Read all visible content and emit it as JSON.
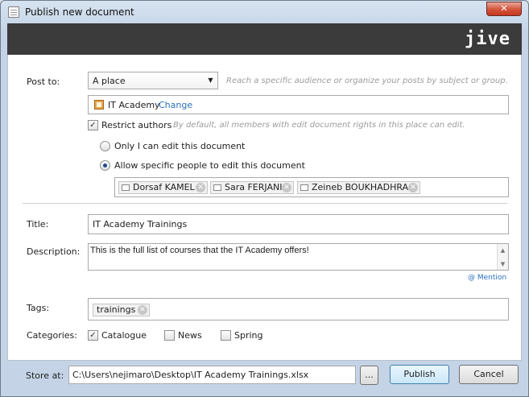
{
  "window": {
    "title": "Publish new document",
    "close_glyph": "✕",
    "brand": "jive",
    "app_icon": "document-icon"
  },
  "post_to": {
    "label": "Post to:",
    "selected": "A place",
    "hint": "Reach a specific audience or organize your posts by subject or group.",
    "place_name": "IT Academy",
    "change_link": "Change"
  },
  "restrict": {
    "label": "Restrict authors",
    "checked": true,
    "hint": "By default, all members with edit document rights in this place can edit.",
    "option_only_me": "Only I can edit this document",
    "option_specific": "Allow specific people to edit this document",
    "selected_option": "specific",
    "people": [
      "Dorsaf KAMEL",
      "Sara FERJANI",
      "Zeineb BOUKHADHRA"
    ]
  },
  "title": {
    "label": "Title:",
    "value": "IT Academy Trainings"
  },
  "description": {
    "label": "Description:",
    "value": "This is the full list of courses that the IT Academy offers!",
    "mention_link": "@ Mention"
  },
  "tags": {
    "label": "Tags:",
    "items": [
      "trainings"
    ]
  },
  "categories": {
    "label": "Categories:",
    "items": [
      {
        "label": "Catalogue",
        "checked": true
      },
      {
        "label": "News",
        "checked": false
      },
      {
        "label": "Spring",
        "checked": false
      }
    ]
  },
  "footer": {
    "store_label": "Store at:",
    "path": "C:\\Users\\nejimaro\\Desktop\\IT Academy Trainings.xlsx",
    "browse_label": "...",
    "publish_label": "Publish",
    "cancel_label": "Cancel"
  },
  "colors": {
    "accent_link": "#2a6fbf",
    "brand_bar": "#3b3b3b",
    "close_button": "#c23a20"
  }
}
